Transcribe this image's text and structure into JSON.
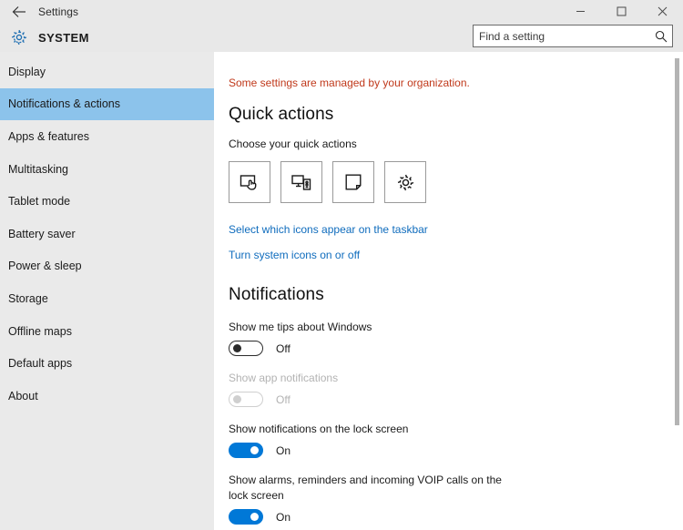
{
  "titlebar": {
    "back_label": "back-arrow",
    "title": "Settings",
    "minimize": "–",
    "maximize": "□",
    "close": "✕"
  },
  "header": {
    "gear_icon": "gear-icon",
    "page_title": "SYSTEM"
  },
  "search": {
    "placeholder": "Find a setting",
    "value": "",
    "icon": "search-icon"
  },
  "sidebar": {
    "items": [
      {
        "label": "Display",
        "active": false
      },
      {
        "label": "Notifications & actions",
        "active": true
      },
      {
        "label": "Apps & features",
        "active": false
      },
      {
        "label": "Multitasking",
        "active": false
      },
      {
        "label": "Tablet mode",
        "active": false
      },
      {
        "label": "Battery saver",
        "active": false
      },
      {
        "label": "Power & sleep",
        "active": false
      },
      {
        "label": "Storage",
        "active": false
      },
      {
        "label": "Offline maps",
        "active": false
      },
      {
        "label": "Default apps",
        "active": false
      },
      {
        "label": "About",
        "active": false
      }
    ]
  },
  "main": {
    "org_note": "Some settings are managed by your organization.",
    "org_note_color": "#c0391b",
    "quick_actions": {
      "heading": "Quick actions",
      "subheading": "Choose your quick actions",
      "tiles": [
        {
          "icon": "tablet-mode-icon",
          "name": "quick-action-tablet-mode"
        },
        {
          "icon": "connect-devices-icon",
          "name": "quick-action-connect"
        },
        {
          "icon": "note-icon",
          "name": "quick-action-note"
        },
        {
          "icon": "gear-icon",
          "name": "quick-action-all-settings"
        }
      ]
    },
    "links": [
      {
        "label": "Select which icons appear on the taskbar"
      },
      {
        "label": "Turn system icons on or off"
      }
    ],
    "notifications": {
      "heading": "Notifications",
      "settings": [
        {
          "label": "Show me tips about Windows",
          "state": "Off",
          "on": false,
          "disabled": false
        },
        {
          "label": "Show app notifications",
          "state": "Off",
          "on": false,
          "disabled": true
        },
        {
          "label": "Show notifications on the lock screen",
          "state": "On",
          "on": true,
          "disabled": false
        },
        {
          "label": "Show alarms, reminders and incoming VOIP calls on the lock screen",
          "state": "On",
          "on": true,
          "disabled": false
        }
      ]
    }
  },
  "colors": {
    "accent": "#0078d7",
    "sidebar_highlight": "#8cc3eb",
    "link": "#0f6cbd",
    "warning": "#c0391b"
  }
}
